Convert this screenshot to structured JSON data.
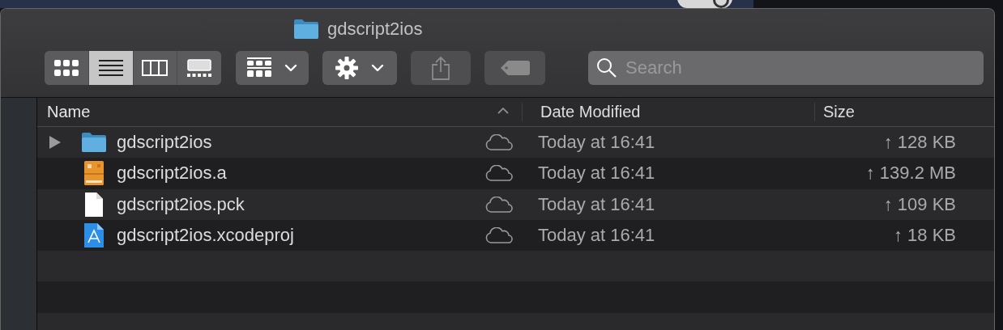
{
  "background_app": {
    "toggle_on": true
  },
  "window": {
    "title": "gdscript2ios"
  },
  "toolbar": {
    "view_modes": [
      {
        "kind": "icons",
        "selected": false
      },
      {
        "kind": "list",
        "selected": true
      },
      {
        "kind": "columns",
        "selected": false
      },
      {
        "kind": "gallery",
        "selected": false
      }
    ],
    "buttons": [
      {
        "kind": "group",
        "disabled": false
      },
      {
        "kind": "action",
        "disabled": false
      },
      {
        "kind": "share",
        "disabled": true
      },
      {
        "kind": "tags",
        "disabled": true
      }
    ],
    "search": {
      "placeholder": "Search"
    }
  },
  "table": {
    "columns": [
      {
        "label": "Name",
        "sorted": true
      },
      {
        "label": "Date Modified",
        "sorted": false
      },
      {
        "label": "Size",
        "sorted": false
      }
    ],
    "rows": [
      {
        "name": "gdscript2ios",
        "kind": "folder",
        "expanded": false,
        "date": "Today at 16:41",
        "size": "↑ 128 KB"
      },
      {
        "name": "gdscript2ios.a",
        "kind": "archive",
        "date": "Today at 16:41",
        "size": "↑ 139.2 MB"
      },
      {
        "name": "gdscript2ios.pck",
        "kind": "document",
        "date": "Today at 16:41",
        "size": "↑ 109 KB"
      },
      {
        "name": "gdscript2ios.xcodeproj",
        "kind": "xcode",
        "date": "Today at 16:41",
        "size": "↑ 18 KB"
      }
    ]
  }
}
